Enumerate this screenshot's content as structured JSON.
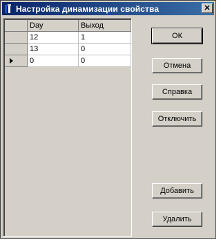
{
  "window": {
    "title": "Настройка динамизации свойства",
    "close_glyph": "✕"
  },
  "grid": {
    "columns": [
      "Day",
      "Выход"
    ],
    "rows": [
      {
        "day": "12",
        "out": "1"
      },
      {
        "day": "13",
        "out": "0"
      },
      {
        "day": "0",
        "out": "0",
        "current": true
      }
    ]
  },
  "buttons": {
    "ok": "ОК",
    "cancel": "Отмена",
    "help": "Справка",
    "disable": "Отключить",
    "add": "Добавить",
    "delete": "Удалить"
  },
  "icons": {
    "app": "app-icon",
    "close": "close-icon",
    "current_row": "row-pointer-icon"
  }
}
